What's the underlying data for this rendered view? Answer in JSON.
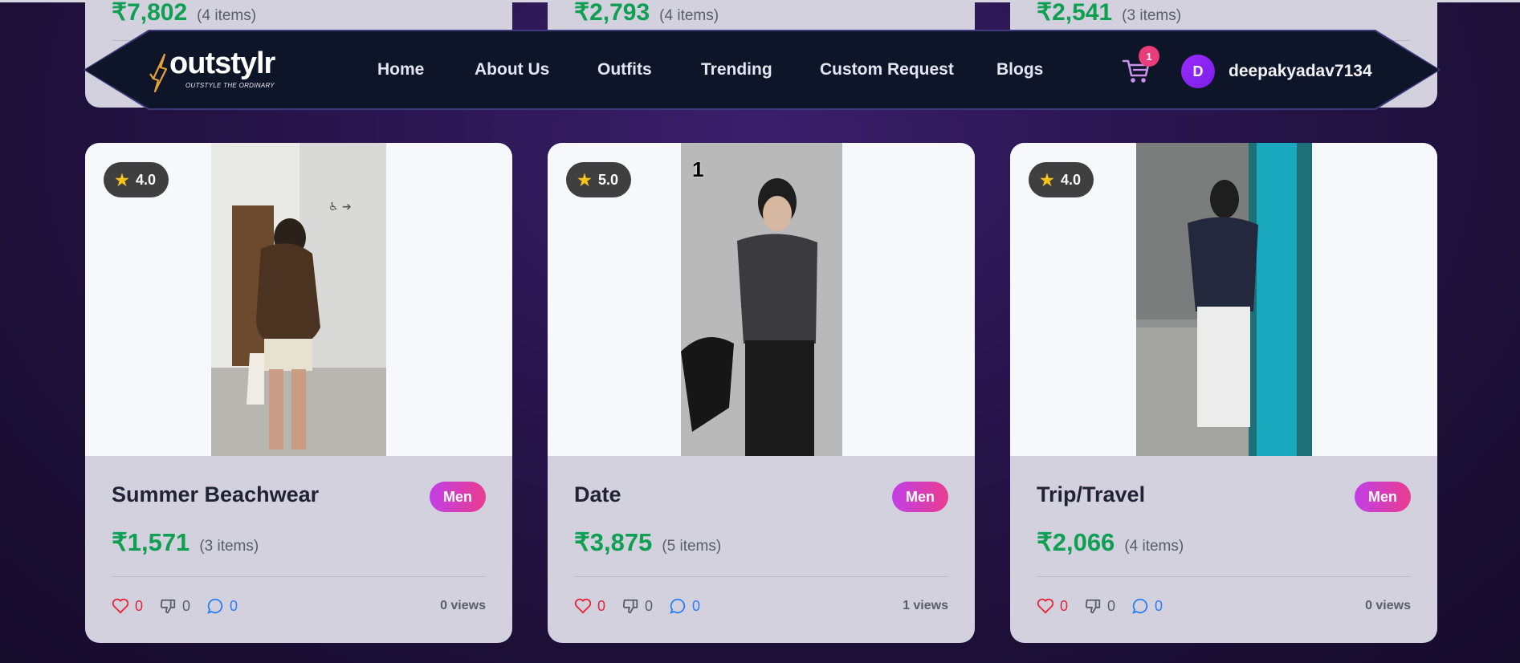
{
  "top_cards": [
    {
      "price": "₹7,802",
      "count": "(4 items)"
    },
    {
      "price": "₹2,793",
      "count": "(4 items)"
    },
    {
      "price": "₹2,541",
      "count": "(3 items)"
    }
  ],
  "navbar": {
    "logo_text": "outstylr",
    "logo_tagline": "OUTSTYLE THE ORDINARY",
    "links": [
      "Home",
      "About Us",
      "Outfits",
      "Trending",
      "Custom Request",
      "Blogs"
    ],
    "cart_count": "1",
    "avatar_initial": "D",
    "username": "deepakyadav7134"
  },
  "cards": [
    {
      "rating": "4.0",
      "title": "Summer Beachwear",
      "tag": "Men",
      "price": "₹1,571",
      "count": "(3 items)",
      "likes": "0",
      "dislikes": "0",
      "comments": "0",
      "views": "0 views"
    },
    {
      "rating": "5.0",
      "title": "Date",
      "tag": "Men",
      "price": "₹3,875",
      "count": "(5 items)",
      "likes": "0",
      "dislikes": "0",
      "comments": "0",
      "views": "1 views",
      "photo_label": "1"
    },
    {
      "rating": "4.0",
      "title": "Trip/Travel",
      "tag": "Men",
      "price": "₹2,066",
      "count": "(4 items)",
      "likes": "0",
      "dislikes": "0",
      "comments": "0",
      "views": "0 views"
    }
  ],
  "colors": {
    "accent_green": "#0e9f53",
    "tag_gradient_start": "#c13ee6",
    "tag_gradient_end": "#e93d8f",
    "nav_bg": "#0f1529",
    "badge_pink": "#e83d7a"
  }
}
